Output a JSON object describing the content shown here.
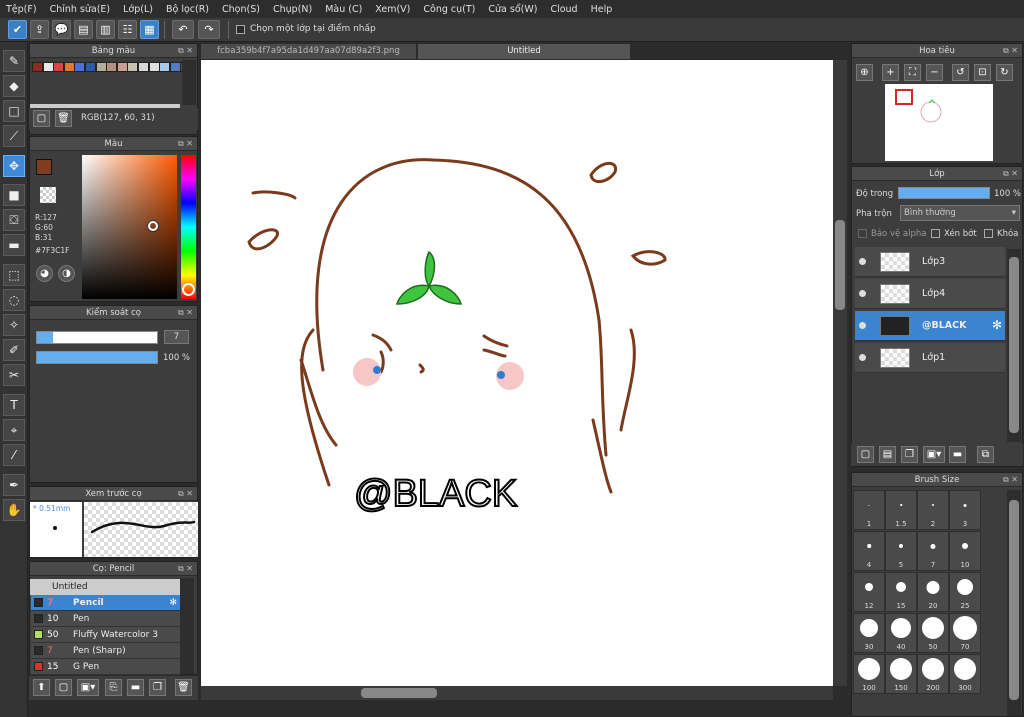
{
  "menu": [
    "Tệp(F)",
    "Chỉnh sửa(E)",
    "Lớp(L)",
    "Bộ lọc(R)",
    "Chọn(S)",
    "Chụp(N)",
    "Màu (C)",
    "Xem(V)",
    "Công cụ(T)",
    "Cửa sổ(W)",
    "Cloud",
    "Help"
  ],
  "toolbar": {
    "select_layer_label": "Chọn một lớp tại điểm nhấp"
  },
  "tabs": {
    "file_tab": "fcba359b4f7a95da1d497aa07d89a2f3.png",
    "untitled_tab": "Untitled"
  },
  "palette": {
    "title": "Bảng màu",
    "rgb": "RGB(127, 60, 31)",
    "swatches": [
      "#8b2e1f",
      "#e8e8e8",
      "#d44",
      "#e07b2c",
      "#4a6fd8",
      "#2a5ba6",
      "#b7ab9a",
      "#b89080",
      "#c8a090",
      "#c9c0b0",
      "#d8d8d8",
      "#e0e0e0",
      "#aac8e8",
      "#4a7fc4",
      "#8b3f2a"
    ]
  },
  "color": {
    "title": "Màu",
    "r": "R:127",
    "g": "G:60",
    "b": "B:31",
    "hex": "#7F3C1F",
    "fg": "#7f3c1f"
  },
  "brush_control": {
    "title": "Kiểm soát cọ",
    "size": "7",
    "opacity": "100 %"
  },
  "brush_preview": {
    "title": "Xem trước cọ",
    "size": "* 0.51mm"
  },
  "brush_list": {
    "title": "Cọ: Pencil",
    "group": "Untitled",
    "items": [
      {
        "n": "7",
        "name": "Pencil",
        "color": "#2a2a2a"
      },
      {
        "n": "10",
        "name": "Pen",
        "color": "#2a2a2a"
      },
      {
        "n": "50",
        "name": "Fluffy Watercolor 3",
        "color": "#b4e060"
      },
      {
        "n": "7",
        "name": "Pen (Sharp)",
        "color": "#2a2a2a"
      },
      {
        "n": "15",
        "name": "G Pen",
        "color": "#e03030"
      }
    ]
  },
  "navigator": {
    "title": "Hoa tiêu"
  },
  "layers": {
    "title": "Lớp",
    "opacity_label": "Độ trong",
    "opacity_value": "100 %",
    "blend_label": "Pha trộn",
    "blend_value": "Bình thường",
    "protect_alpha": "Bảo vệ alpha",
    "clipping": "Xén bớt",
    "lock": "Khóa",
    "items": [
      "Lớp3",
      "Lớp4",
      "@BLACK",
      "Lớp1"
    ],
    "selected_index": 2
  },
  "brush_size": {
    "title": "Brush Size",
    "sizes": [
      "1",
      "1.5",
      "2",
      "3",
      "4",
      "5",
      "7",
      "10",
      "12",
      "15",
      "20",
      "25",
      "30",
      "40",
      "50",
      "70",
      "100",
      "150",
      "200",
      "300"
    ]
  },
  "artwork": {
    "watermark": "@BLACK"
  }
}
